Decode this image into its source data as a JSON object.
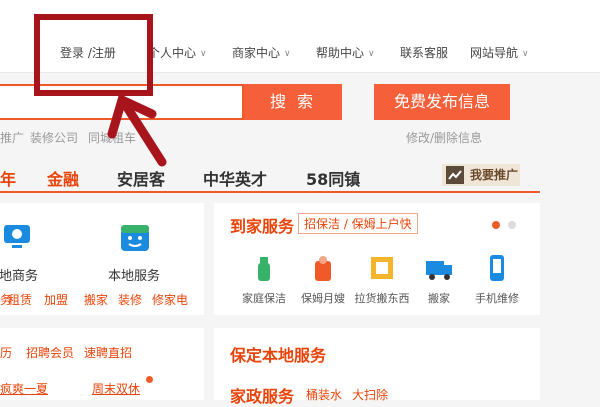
{
  "nav": {
    "login_register": "登录 /注册",
    "user_center": "个人中心",
    "merchant_center": "商家中心",
    "help_center": "帮助中心",
    "contact_service": "联系客服",
    "site_nav": "网站导航"
  },
  "search": {
    "button_label": "搜 索",
    "post_label": "免费发布信息",
    "links": [
      "推广",
      "装修公司",
      "同城租车"
    ],
    "manage_link": "修改/删除信息"
  },
  "categories": [
    "年",
    "金融",
    "安居客",
    "中华英才",
    "58同镇"
  ],
  "promote_label": "我要推广",
  "left_card": {
    "services": [
      {
        "label": "本地商务",
        "icon": "monitor-icon"
      },
      {
        "label": "本地服务",
        "icon": "smiley-house-icon"
      }
    ],
    "commerce_links": [
      "务",
      "租赁",
      "加盟"
    ],
    "service_links": [
      "搬家",
      "装修",
      "修家电"
    ]
  },
  "home_service": {
    "title": "到家服务",
    "tag": "招保洁 / 保姆上户快",
    "items": [
      {
        "label": "家庭保洁",
        "icon": "cleaning-icon"
      },
      {
        "label": "保姆月嫂",
        "icon": "nanny-icon"
      },
      {
        "label": "拉货搬东西",
        "icon": "cargo-icon"
      },
      {
        "label": "搬家",
        "icon": "truck-icon"
      },
      {
        "label": "手机维修",
        "icon": "phone-repair-icon"
      }
    ]
  },
  "jobs_card": {
    "links": [
      "历",
      "招聘会员",
      "速聘直招"
    ],
    "links2": [
      "疯爽一夏",
      "周末双休"
    ]
  },
  "local_service": {
    "title": "保定本地服务",
    "subtitle": "家政服务",
    "links": [
      "桶装水",
      "大扫除"
    ]
  },
  "colors": {
    "accent": "#f05a28",
    "annotation": "#a8141c"
  }
}
